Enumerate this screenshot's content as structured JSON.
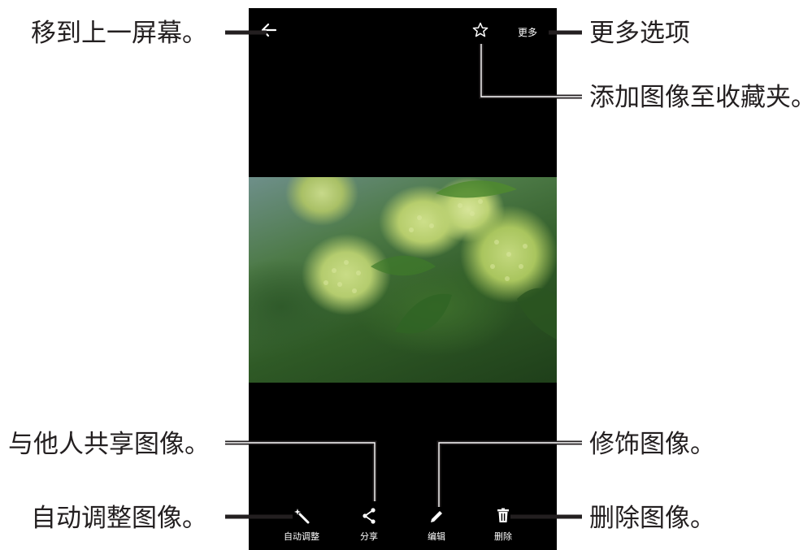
{
  "callouts": {
    "back": "移到上一屏幕。",
    "more": "更多选项",
    "favorite": "添加图像至收藏夹。",
    "share": "与他人共享图像。",
    "edit": "修饰图像。",
    "auto_adjust": "自动调整图像。",
    "delete": "删除图像。"
  },
  "phone": {
    "top_bar": {
      "back_icon": "arrow-left-icon",
      "favorite_icon": "star-outline-icon",
      "more_label": "更多"
    },
    "bottom_bar": {
      "items": [
        {
          "icon": "magic-wand-icon",
          "label": "自动调整"
        },
        {
          "icon": "share-icon",
          "label": "分享"
        },
        {
          "icon": "pencil-icon",
          "label": "编辑"
        },
        {
          "icon": "trash-icon",
          "label": "删除"
        }
      ]
    }
  },
  "colors": {
    "screen_background": "#000000",
    "callout_line": "#231f20",
    "icon": "#ffffff"
  }
}
